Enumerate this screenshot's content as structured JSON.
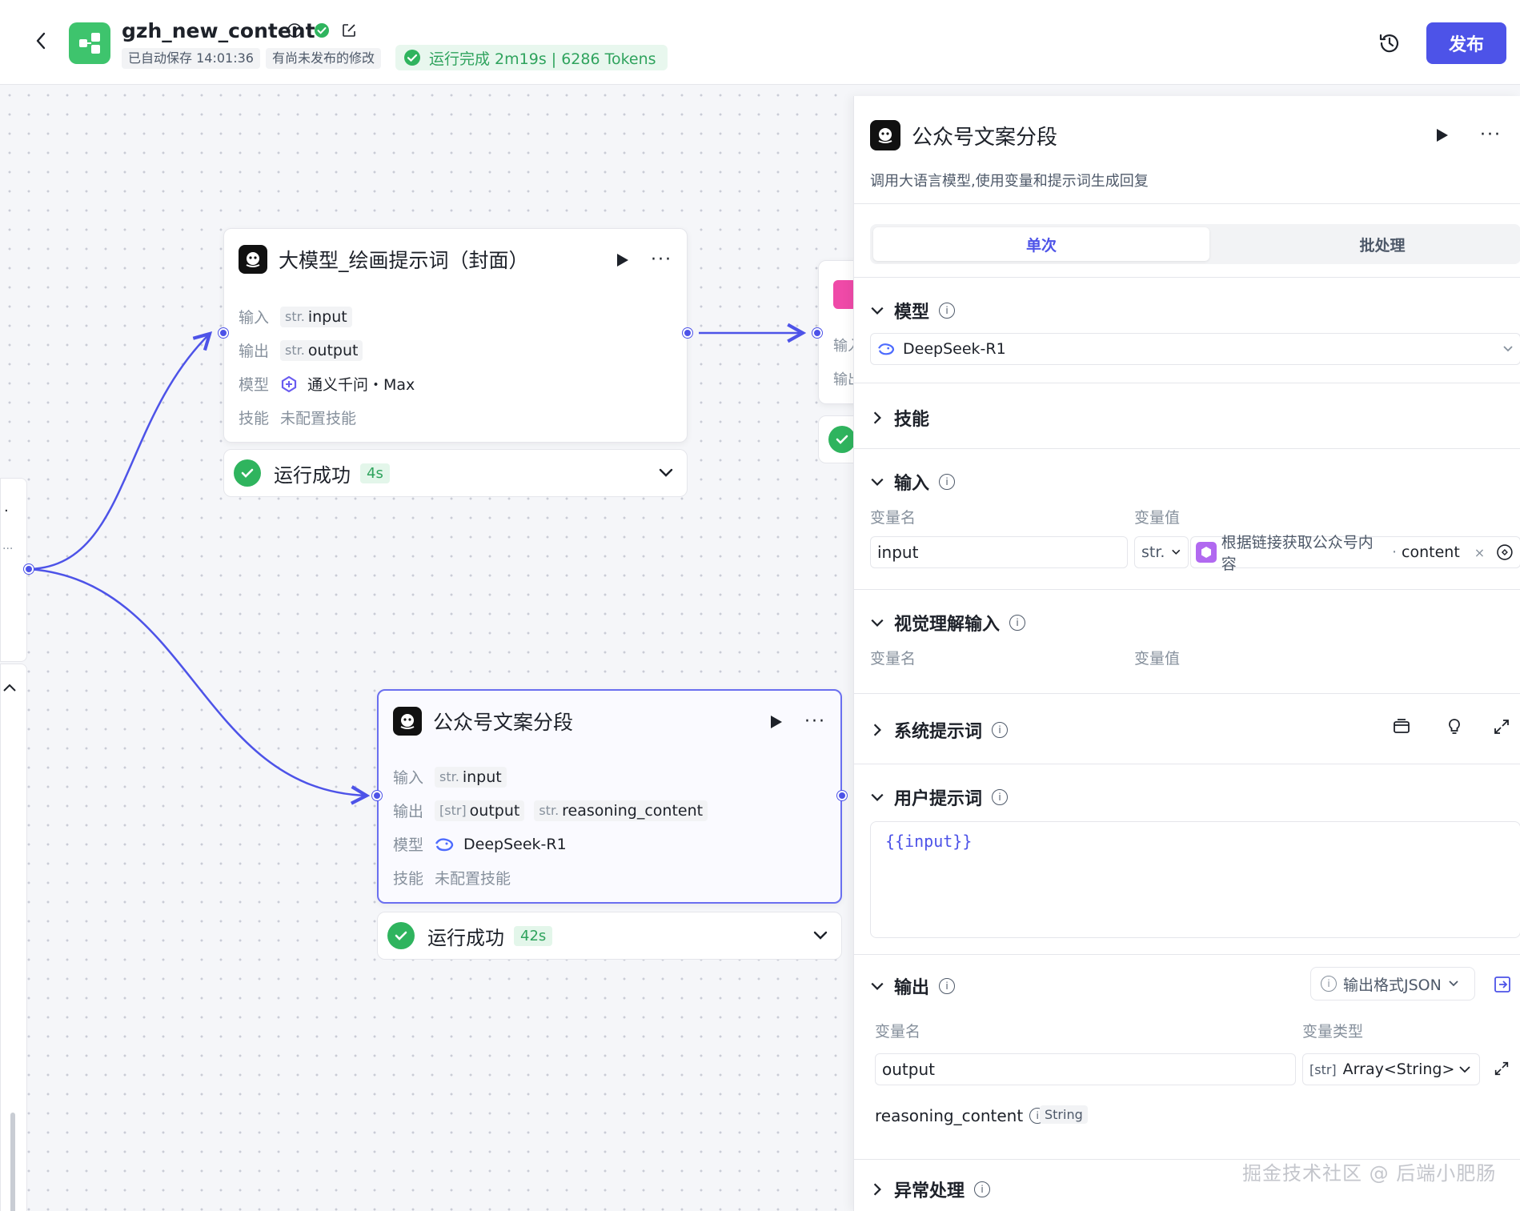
{
  "header": {
    "app_name": "gzh_new_content",
    "autosave": "已自动保存 14:01:36",
    "unpublished": "有尚未发布的修改",
    "run_status": "运行完成 2m19s | 6286 Tokens",
    "publish_label": "发布"
  },
  "nodes": {
    "draw_prompt": {
      "title": "大模型_绘画提示词（封面）",
      "input_label": "输入",
      "input_type": "str.",
      "input_name": "input",
      "output_label": "输出",
      "output_type": "str.",
      "output_name": "output",
      "model_label": "模型",
      "model_name": "通义千问・Max",
      "skill_label": "技能",
      "skill_value": "未配置技能",
      "run_status": "运行成功",
      "run_time": "4s"
    },
    "gzh_segment": {
      "title": "公众号文案分段",
      "input_label": "输入",
      "input_type": "str.",
      "input_name": "input",
      "output_label": "输出",
      "output_type": "[str]",
      "output_name": "output",
      "output2_type": "str.",
      "output2_name": "reasoning_content",
      "model_label": "模型",
      "model_name": "DeepSeek-R1",
      "skill_label": "技能",
      "skill_value": "未配置技能",
      "run_status": "运行成功",
      "run_time": "42s"
    },
    "partial_right": {
      "row1": "输入",
      "row2": "输出"
    }
  },
  "panel": {
    "title": "公众号文案分段",
    "description": "调用大语言模型,使用变量和提示词生成回复",
    "tab_single": "单次",
    "tab_batch": "批处理",
    "model_section": "模型",
    "model_value": "DeepSeek-R1",
    "skills_section": "技能",
    "input_section": "输入",
    "col_var_name": "变量名",
    "col_var_value": "变量值",
    "input_var_name": "input",
    "input_var_type": "str.",
    "input_ref_node": "根据链接获取公众号内容",
    "input_ref_field": "content",
    "vision_section": "视觉理解输入",
    "system_prompt_section": "系统提示词",
    "user_prompt_section": "用户提示词",
    "user_prompt_value": "{{input}}",
    "output_section": "输出",
    "output_format": "输出格式JSON",
    "col_var_type": "变量类型",
    "output_var_name": "output",
    "output_type_prefix": "[str]",
    "output_var_type": "Array<String>",
    "reasoning_name": "reasoning_content",
    "reasoning_type": "String",
    "exception_section": "异常处理"
  },
  "watermark": "掘金技术社区 @ 后端小肥肠",
  "colors": {
    "accent": "#4d53e8",
    "success": "#2fb45e",
    "app_logo": "#3ec46d"
  }
}
